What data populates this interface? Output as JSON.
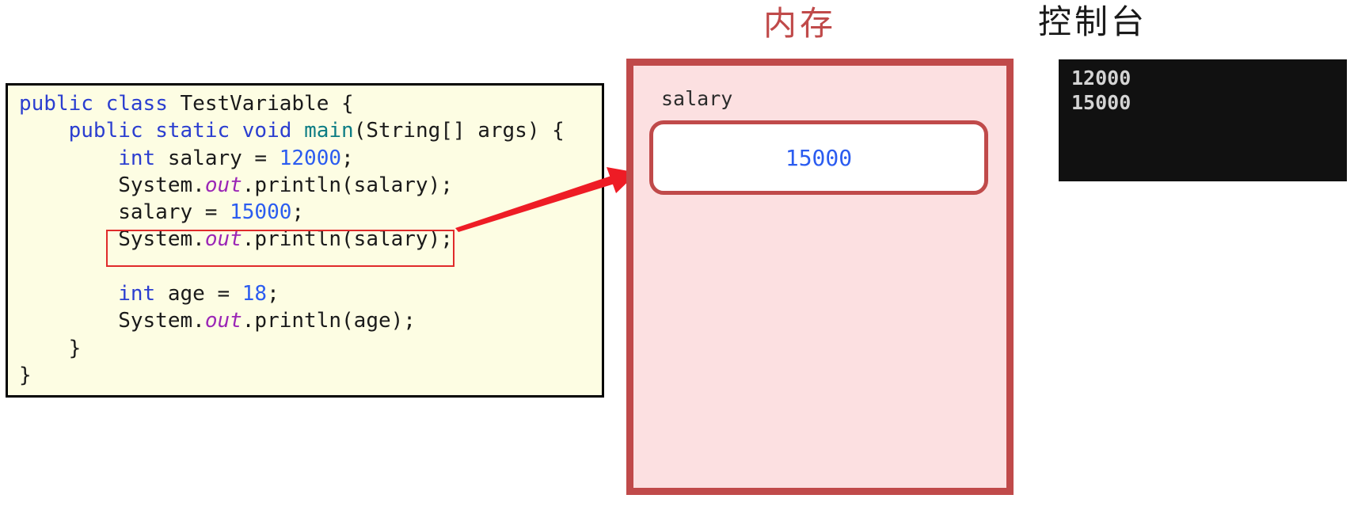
{
  "code_panel": {
    "language": "java",
    "lines": [
      [
        {
          "t": "public",
          "c": "kw"
        },
        {
          "t": " ",
          "c": "plain"
        },
        {
          "t": "class",
          "c": "kw"
        },
        {
          "t": " TestVariable {",
          "c": "plain"
        }
      ],
      [
        {
          "t": "    ",
          "c": "plain"
        },
        {
          "t": "public",
          "c": "kw"
        },
        {
          "t": " ",
          "c": "plain"
        },
        {
          "t": "static",
          "c": "kw"
        },
        {
          "t": " ",
          "c": "plain"
        },
        {
          "t": "void",
          "c": "kw"
        },
        {
          "t": " ",
          "c": "plain"
        },
        {
          "t": "main",
          "c": "meth"
        },
        {
          "t": "(String[] args) {",
          "c": "plain"
        }
      ],
      [
        {
          "t": "        ",
          "c": "plain"
        },
        {
          "t": "int",
          "c": "kw"
        },
        {
          "t": " salary = ",
          "c": "plain"
        },
        {
          "t": "12000",
          "c": "num"
        },
        {
          "t": ";",
          "c": "plain"
        }
      ],
      [
        {
          "t": "        System.",
          "c": "plain"
        },
        {
          "t": "out",
          "c": "fld"
        },
        {
          "t": ".println(salary);",
          "c": "plain"
        }
      ],
      [
        {
          "t": "        salary = ",
          "c": "plain"
        },
        {
          "t": "15000",
          "c": "num"
        },
        {
          "t": ";",
          "c": "plain"
        }
      ],
      [
        {
          "t": "        System.",
          "c": "plain"
        },
        {
          "t": "out",
          "c": "fld"
        },
        {
          "t": ".println(salary);",
          "c": "plain"
        }
      ],
      [
        {
          "t": "",
          "c": "plain"
        }
      ],
      [
        {
          "t": "        ",
          "c": "plain"
        },
        {
          "t": "int",
          "c": "kw"
        },
        {
          "t": " age = ",
          "c": "plain"
        },
        {
          "t": "18",
          "c": "num"
        },
        {
          "t": ";",
          "c": "plain"
        }
      ],
      [
        {
          "t": "        System.",
          "c": "plain"
        },
        {
          "t": "out",
          "c": "fld"
        },
        {
          "t": ".println(age);",
          "c": "plain"
        }
      ],
      [
        {
          "t": "    }",
          "c": "plain"
        }
      ],
      [
        {
          "t": "}",
          "c": "plain"
        }
      ]
    ],
    "highlighted_line_text": "System.out.println(salary);",
    "highlight_color": "#e02b2b",
    "background_color": "#fdfde3"
  },
  "memory": {
    "title": "内存",
    "title_color": "#c04a4a",
    "variable_label": "salary",
    "value": "15000",
    "value_color": "#2b5cf0",
    "panel_fill": "#fce0e1",
    "panel_border": "#c04a4a"
  },
  "console": {
    "title": "控制台",
    "title_color": "#1a1a1a",
    "background_color": "#111111",
    "text_color": "#d4d4d4",
    "lines": [
      "12000",
      "15000"
    ]
  },
  "arrow": {
    "name": "execution-to-memory-arrow",
    "color": "#ee1c25",
    "from": "highlighted-code-line",
    "to": "memory-panel"
  }
}
